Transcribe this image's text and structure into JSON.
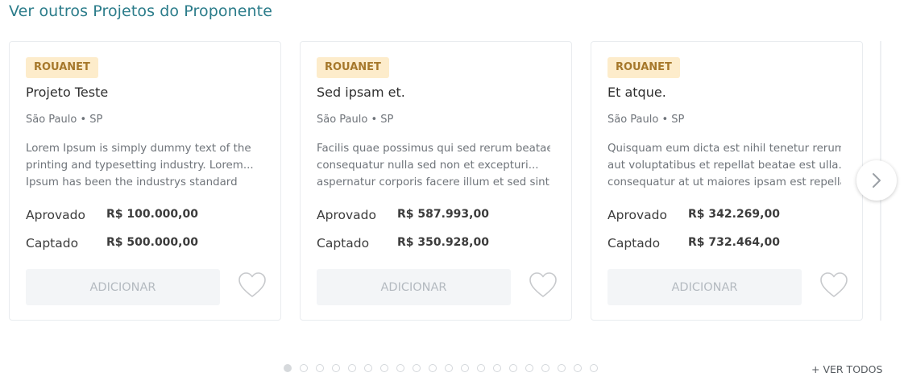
{
  "section": {
    "title": "Ver outros Projetos do Proponente"
  },
  "cards": [
    {
      "badge": "ROUANET",
      "title": "Projeto Teste",
      "location": "São Paulo • SP",
      "description": [
        "Lorem Ipsum is simply dummy text of the",
        "printing and typesetting industry. Lorem...",
        "Ipsum has been the industrys standard"
      ],
      "approved_label": "Aprovado",
      "approved_value": "R$ 100.000,00",
      "raised_label": "Captado",
      "raised_value": "R$ 500.000,00",
      "add_label": "ADICIONAR"
    },
    {
      "badge": "ROUANET",
      "title": "Sed ipsam et.",
      "location": "São Paulo • SP",
      "description": [
        "Facilis quae possimus qui sed rerum beatae",
        "consequatur nulla sed non et excepturi...",
        "aspernatur corporis facere illum et sed sint"
      ],
      "approved_label": "Aprovado",
      "approved_value": "R$ 587.993,00",
      "raised_label": "Captado",
      "raised_value": "R$ 350.928,00",
      "add_label": "ADICIONAR"
    },
    {
      "badge": "ROUANET",
      "title": "Et atque.",
      "location": "São Paulo • SP",
      "description": [
        "Quisquam eum dicta est nihil tenetur rerum",
        "aut voluptatibus et repellat beatae est ulla...",
        "consequatur at ut maiores ipsam est repellat"
      ],
      "approved_label": "Aprovado",
      "approved_value": "R$ 342.269,00",
      "raised_label": "Captado",
      "raised_value": "R$ 732.464,00",
      "add_label": "ADICIONAR"
    }
  ],
  "icons": {
    "heart": "heart-outline-icon",
    "next": "chevron-right-icon"
  },
  "pagination": {
    "total": 20,
    "active": 1
  },
  "see_all": "+ VER TODOS",
  "colors": {
    "title": "#2b7c8a",
    "badge_bg": "#fdeccb",
    "badge_text": "#a6782b"
  }
}
